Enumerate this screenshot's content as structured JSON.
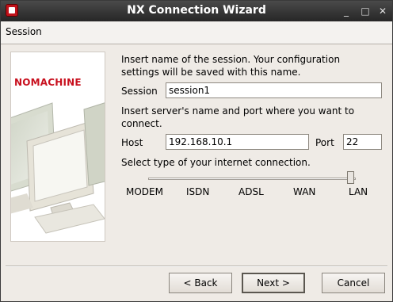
{
  "window": {
    "title": "NX Connection Wizard",
    "controls": {
      "minimize": "_",
      "maximize": "□",
      "close": "✕"
    }
  },
  "header": {
    "title": "Session"
  },
  "brand": {
    "logo_text": "NOMACHINE",
    "logo_color": "#c8101e"
  },
  "form": {
    "session_intro": "Insert name of the session. Your configuration settings will be saved with this name.",
    "session_intro_lines": [
      "Insert name of the session. Your configuration",
      "settings will be saved with this name."
    ],
    "session_label": "Session",
    "session_value": "session1",
    "server_intro_lines": [
      "Insert server's name and port where you want to",
      "connect."
    ],
    "host_label": "Host",
    "host_value": "192.168.10.1",
    "port_label": "Port",
    "port_value": "22",
    "connection_intro": "Select type of your internet connection.",
    "connection_types": [
      "MODEM",
      "ISDN",
      "ADSL",
      "WAN",
      "LAN"
    ],
    "connection_selected": "LAN"
  },
  "buttons": {
    "back": "< Back",
    "next": "Next >",
    "cancel": "Cancel"
  }
}
